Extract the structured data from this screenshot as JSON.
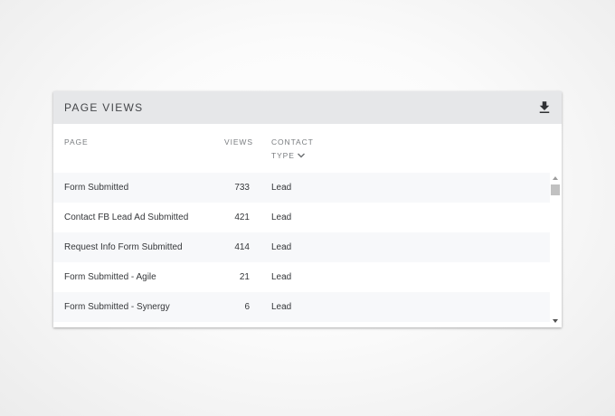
{
  "widget": {
    "title": "PAGE VIEWS",
    "download_icon": "download-icon"
  },
  "table": {
    "columns": {
      "page": "PAGE",
      "views": "VIEWS",
      "contact_type_line1": "CONTACT",
      "contact_type_line2": "TYPE",
      "sort_icon": "chevron-down-icon"
    },
    "rows": [
      {
        "page": "Form Submitted",
        "views": "733",
        "type": "Lead"
      },
      {
        "page": "Contact FB Lead Ad Submitted",
        "views": "421",
        "type": "Lead"
      },
      {
        "page": "Request Info Form Submitted",
        "views": "414",
        "type": "Lead"
      },
      {
        "page": "Form Submitted - Agile",
        "views": "21",
        "type": "Lead"
      },
      {
        "page": "Form Submitted - Synergy",
        "views": "6",
        "type": "Lead"
      }
    ]
  },
  "colors": {
    "header_bg": "#e6e7e9",
    "alt_row_bg": "#f7f8fa",
    "text": "#35373a"
  }
}
